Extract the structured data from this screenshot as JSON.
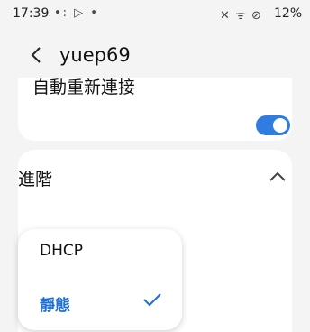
{
  "status": {
    "time": "17:39",
    "left_icons": "•: ▷ •",
    "right_icons": "✕ ᯤ ⊘",
    "battery": "12%"
  },
  "header": {
    "title": "yuep69"
  },
  "settings": {
    "auto_reconnect_label": "自動重新連接",
    "auto_reconnect_on": true,
    "advanced_label": "進階"
  },
  "dropdown": {
    "options": [
      "DHCP",
      "靜態"
    ],
    "selected": "靜態"
  },
  "colors": {
    "accent": "#2f7de0",
    "selected_text": "#1f6fd0"
  }
}
